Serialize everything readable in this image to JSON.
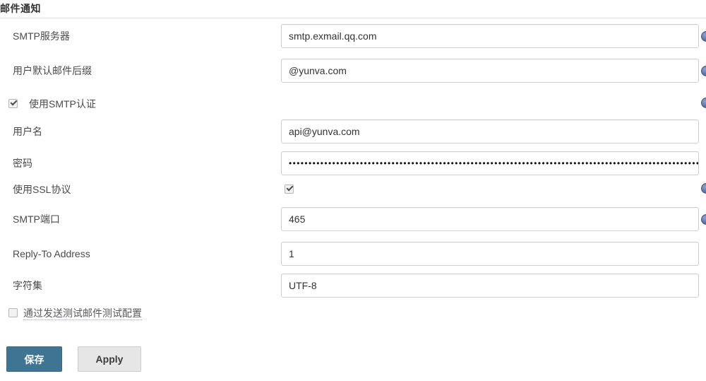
{
  "section": {
    "title": "邮件通知"
  },
  "fields": {
    "smtp_server": {
      "label": "SMTP服务器",
      "value": "smtp.exmail.qq.com",
      "placeholder": ""
    },
    "default_mail_suffix": {
      "label": "用户默认邮件后缀",
      "value": "@yunva.com",
      "placeholder": ""
    },
    "use_smtp_auth": {
      "label": "使用SMTP认证",
      "checked": true
    },
    "username": {
      "label": "用户名",
      "value": "api@yunva.com",
      "placeholder": ""
    },
    "password": {
      "label": "密码",
      "value": "••••••••••••••••••••••••••••••••••••••••••••••••••••••••••••••••••••••••••••••••••••••••••••••••••••••••••",
      "placeholder": ""
    },
    "use_ssl": {
      "label": "使用SSL协议",
      "checked": true
    },
    "smtp_port": {
      "label": "SMTP端口",
      "value": "465",
      "placeholder": ""
    },
    "reply_to_address": {
      "label": "Reply-To Address",
      "value": "1",
      "placeholder": ""
    },
    "charset": {
      "label": "字符集",
      "value": "UTF-8",
      "placeholder": ""
    },
    "send_test_mail": {
      "label": "通过发送测试邮件测试配置",
      "checked": false
    }
  },
  "help_icons": {
    "name": "help-info-icon"
  },
  "buttons": {
    "save": "保存",
    "apply": "Apply"
  },
  "colors": {
    "save_button": "#3f7492",
    "apply_button": "#e6e6e6",
    "help_icon": "#5d74a8",
    "rule": "#e4e4e4",
    "field_border": "#cfcfcf"
  }
}
